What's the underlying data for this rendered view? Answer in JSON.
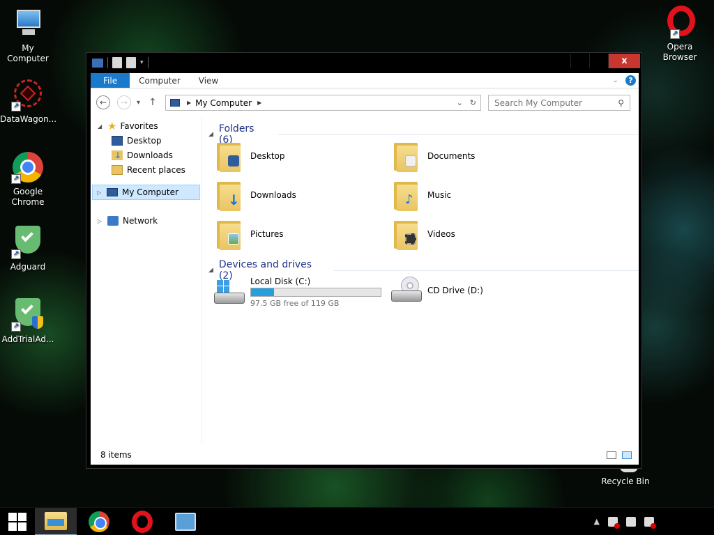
{
  "desktop": {
    "icons": [
      {
        "label": "My Computer",
        "icon": "computer-icon"
      },
      {
        "label": "DataWagon...",
        "icon": "datawagon-icon"
      },
      {
        "label": "Google Chrome",
        "icon": "chrome-icon"
      },
      {
        "label": "Adguard",
        "icon": "adguard-icon"
      },
      {
        "label": "AddTrialAd...",
        "icon": "addtrial-icon"
      },
      {
        "label": "Opera Browser",
        "icon": "opera-icon"
      },
      {
        "label": "Recycle Bin",
        "icon": "recycle-bin-icon"
      }
    ]
  },
  "window": {
    "close_label": "x",
    "ribbon": {
      "tabs": [
        {
          "label": "File"
        },
        {
          "label": "Computer"
        },
        {
          "label": "View"
        }
      ],
      "help_label": "?"
    },
    "address": {
      "path": "My Computer"
    },
    "search": {
      "placeholder": "Search My Computer"
    },
    "nav_pane": {
      "favorites": "Favorites",
      "favorite_items": [
        "Desktop",
        "Downloads",
        "Recent places"
      ],
      "my_computer": "My Computer",
      "network": "Network"
    },
    "folders": {
      "heading": "Folders (6)",
      "items": [
        "Desktop",
        "Documents",
        "Downloads",
        "Music",
        "Pictures",
        "Videos"
      ]
    },
    "drives": {
      "heading": "Devices and drives (2)",
      "items": [
        {
          "name": "Local Disk (C:)",
          "free_text": "97.5 GB free of 119 GB",
          "used_fraction": 0.18
        },
        {
          "name": "CD Drive (D:)"
        }
      ]
    },
    "status": {
      "items_count": "8 items"
    }
  },
  "colors": {
    "accent": "#1979ca",
    "bar_fill": "#26a0da",
    "close": "#c7372f"
  }
}
